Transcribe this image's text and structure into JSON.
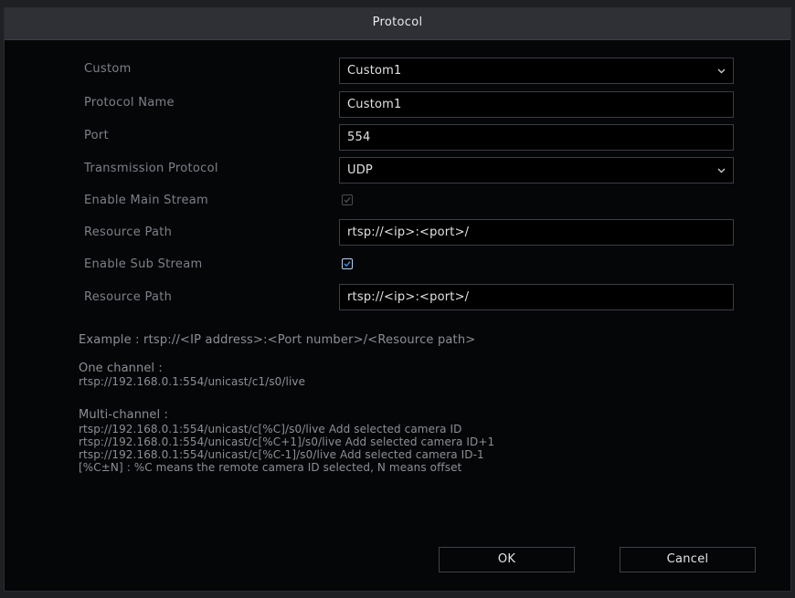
{
  "dialog": {
    "title": "Protocol"
  },
  "form": {
    "custom": {
      "label": "Custom",
      "value": "Custom1"
    },
    "protocol_name": {
      "label": "Protocol Name",
      "value": "Custom1"
    },
    "port": {
      "label": "Port",
      "value": "554"
    },
    "transmission_protocol": {
      "label": "Transmission Protocol",
      "value": "UDP"
    },
    "enable_main_stream": {
      "label": "Enable Main Stream",
      "checked": true,
      "disabled": true
    },
    "main_resource_path": {
      "label": "Resource Path",
      "value": "rtsp://<ip>:<port>/"
    },
    "enable_sub_stream": {
      "label": "Enable Sub Stream",
      "checked": true,
      "disabled": false
    },
    "sub_resource_path": {
      "label": "Resource Path",
      "value": "rtsp://<ip>:<port>/"
    }
  },
  "help": {
    "example": "Example : rtsp://<IP address>:<Port number>/<Resource path>",
    "one_channel_title": "One channel :",
    "one_channel_url": "rtsp://192.168.0.1:554/unicast/c1/s0/live",
    "multi_channel_title": "Multi-channel :",
    "multi_lines": [
      "rtsp://192.168.0.1:554/unicast/c[%C]/s0/live Add selected camera ID",
      "rtsp://192.168.0.1:554/unicast/c[%C+1]/s0/live Add selected camera ID+1",
      "rtsp://192.168.0.1:554/unicast/c[%C-1]/s0/live Add selected camera ID-1",
      "[%C±N] : %C means the remote camera ID selected, N means offset"
    ]
  },
  "buttons": {
    "ok": "OK",
    "cancel": "Cancel"
  },
  "icons": {
    "dropdown": "chevron-down-icon",
    "check": "check-icon"
  },
  "colors": {
    "checkbox_active": "#3f8ce6",
    "background": "#050608",
    "titlebar": "#2e3035"
  }
}
